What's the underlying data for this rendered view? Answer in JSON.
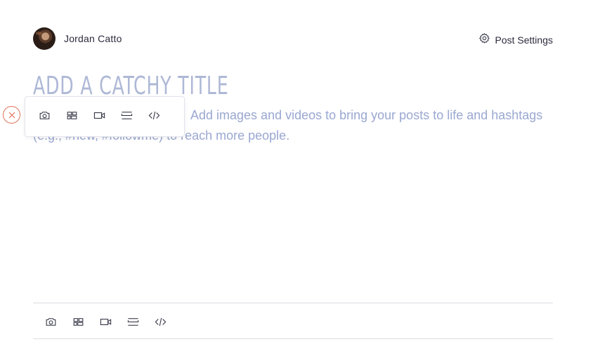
{
  "author": {
    "name": "Jordan Catto",
    "avatar_icon": "user-avatar"
  },
  "header": {
    "settings_label": "Post Settings",
    "settings_icon": "gear-icon"
  },
  "editor": {
    "title_placeholder": "ADD A CATCHY TITLE",
    "body_placeholder": "Add images and videos to bring your posts to life and hashtags (e.g., #new, #followme) to reach more people."
  },
  "toolbar": {
    "items": [
      {
        "icon": "camera-icon",
        "label": "Image"
      },
      {
        "icon": "gallery-icon",
        "label": "Gallery"
      },
      {
        "icon": "video-icon",
        "label": "Video"
      },
      {
        "icon": "divider-icon",
        "label": "Divider"
      },
      {
        "icon": "code-icon",
        "label": "HTML Code"
      }
    ]
  },
  "colors": {
    "accent": "#e0735d",
    "placeholder": "#9aa7d1",
    "title_placeholder": "#aeb8d6",
    "text": "#2b2b3d",
    "border": "#dcdce4"
  }
}
